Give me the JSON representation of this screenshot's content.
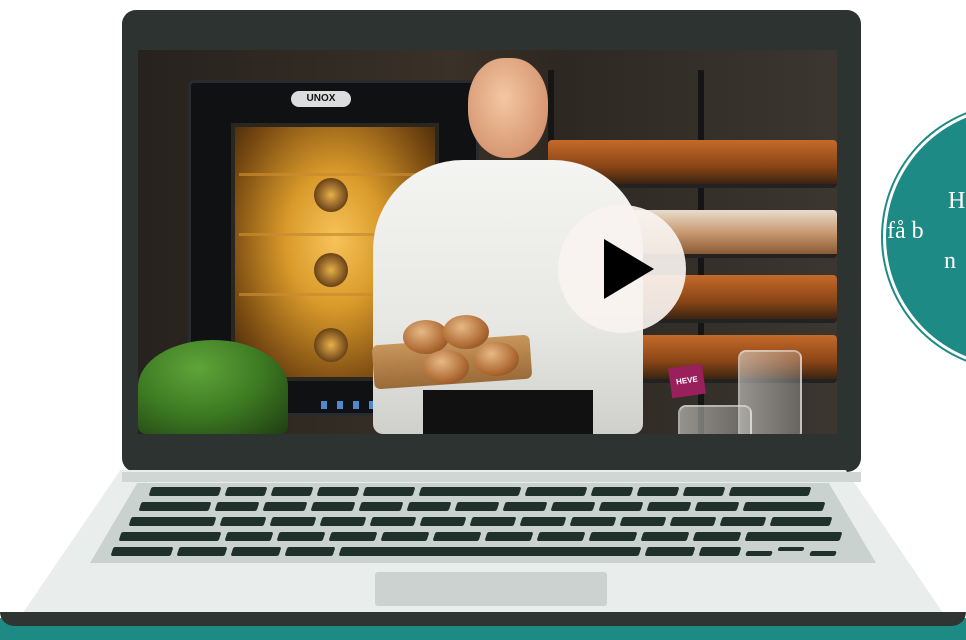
{
  "video": {
    "oven_logo": "UNOX",
    "product_tag": "HEVE",
    "play_button": "play-icon"
  },
  "badge": {
    "lines": [
      "H",
      "få b",
      "n"
    ]
  },
  "colors": {
    "accent_teal": "#1e8a85",
    "laptop_dark": "#2d3331",
    "laptop_body": "#e9eeec",
    "key_color": "#20302b"
  }
}
